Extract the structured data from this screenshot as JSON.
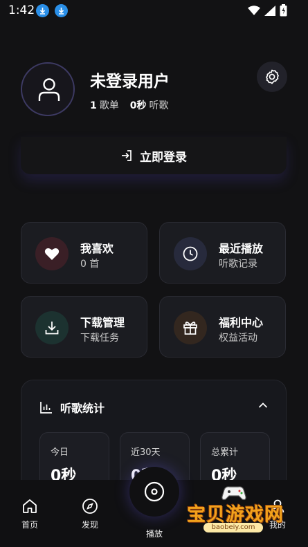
{
  "status_bar": {
    "time": "1:42"
  },
  "profile": {
    "username": "未登录用户",
    "playlists_count": "1",
    "playlists_label": "歌单",
    "listen_time": "0秒",
    "listen_label": "听歌"
  },
  "login": {
    "label": "立即登录"
  },
  "tiles": [
    {
      "title": "我喜欢",
      "subtitle": "0 首",
      "icon": "heart-icon",
      "icon_bg": "#3a1f26"
    },
    {
      "title": "最近播放",
      "subtitle": "听歌记录",
      "icon": "clock-icon",
      "icon_bg": "#272a3c"
    },
    {
      "title": "下载管理",
      "subtitle": "下载任务",
      "icon": "download-icon",
      "icon_bg": "#1c3230"
    },
    {
      "title": "福利中心",
      "subtitle": "权益活动",
      "icon": "gift-icon",
      "icon_bg": "#33271f"
    }
  ],
  "listening_stats": {
    "title": "听歌统计",
    "periods": [
      {
        "label": "今日",
        "value": "0秒"
      },
      {
        "label": "近30天",
        "value": "0秒"
      },
      {
        "label": "总累计",
        "value": "0秒"
      }
    ]
  },
  "bottom_nav": {
    "home": "首页",
    "discover": "发现",
    "play": "播放",
    "mine": "我的"
  },
  "watermark": {
    "title": "宝贝游戏网",
    "url": "baobeiy.com"
  },
  "colors": {
    "background": "#121214",
    "accent": "#3d3a63",
    "tile_bg": "#1b1c21"
  }
}
